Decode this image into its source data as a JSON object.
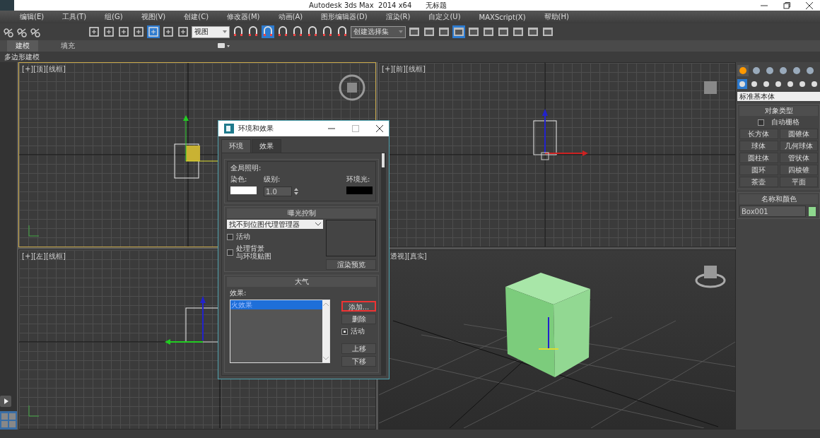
{
  "window": {
    "title": "Autodesk 3ds Max  2014 x64",
    "document": "无标题"
  },
  "menu": [
    "编辑(E)",
    "工具(T)",
    "组(G)",
    "视图(V)",
    "创建(C)",
    "修改器(M)",
    "动画(A)",
    "图形编辑器(D)",
    "渲染(R)",
    "自定义(U)",
    "MAXScript(X)",
    "帮助(H)"
  ],
  "toolbar": {
    "view_dropdown": "视图",
    "selection_set_dropdown": "创建选择集"
  },
  "ribbon": {
    "tabs": [
      {
        "label": "建模",
        "selected": true
      },
      {
        "label": "填充",
        "selected": false
      }
    ],
    "panel": "多边形建模"
  },
  "viewports": [
    {
      "label": "[+][顶][线框]",
      "active": true,
      "kind": "top"
    },
    {
      "label": "[+][前][线框]",
      "active": false,
      "kind": "front"
    },
    {
      "label": "[+][左][线框]",
      "active": false,
      "kind": "left"
    },
    {
      "label": "透视][真实]",
      "active": false,
      "kind": "perspective"
    }
  ],
  "command_panel": {
    "dropdown": "标准基本体",
    "object_type": {
      "title": "对象类型",
      "autogrid": {
        "label": "自动栅格",
        "checked": false
      },
      "buttons": [
        "长方体",
        "圆锥体",
        "球体",
        "几何球体",
        "圆柱体",
        "管状体",
        "圆环",
        "四棱锥",
        "茶壶",
        "平面"
      ]
    },
    "name_color": {
      "title": "名称和颜色",
      "name": "Box001",
      "color": "#8ed88e"
    }
  },
  "dialog": {
    "title": "环境和效果",
    "tabs": [
      {
        "label": "环境",
        "selected": true
      },
      {
        "label": "效果",
        "selected": false
      }
    ],
    "global_lighting": {
      "title": "全局照明:",
      "tint_label": "染色:",
      "level_label": "级别:",
      "level": "1.0",
      "ambient_label": "环境光:"
    },
    "exposure": {
      "title": "曝光控制",
      "dropdown": "找不到位图代理管理器",
      "active": {
        "label": "活动",
        "checked": false
      },
      "process_background": {
        "label_lines": [
          "处理背景",
          "与环境贴图"
        ],
        "checked": false
      },
      "render_preview": "渲染预览"
    },
    "atmosphere": {
      "title": "大气",
      "effects_label": "效果:",
      "effects": [
        {
          "label": "火效果",
          "selected": true
        }
      ],
      "buttons": [
        {
          "label": "添加...",
          "highlighted": true
        },
        {
          "label": "删除",
          "highlighted": false
        }
      ],
      "active": {
        "label": "活动",
        "checked": true
      },
      "move_buttons": [
        "上移",
        "下移"
      ]
    }
  }
}
